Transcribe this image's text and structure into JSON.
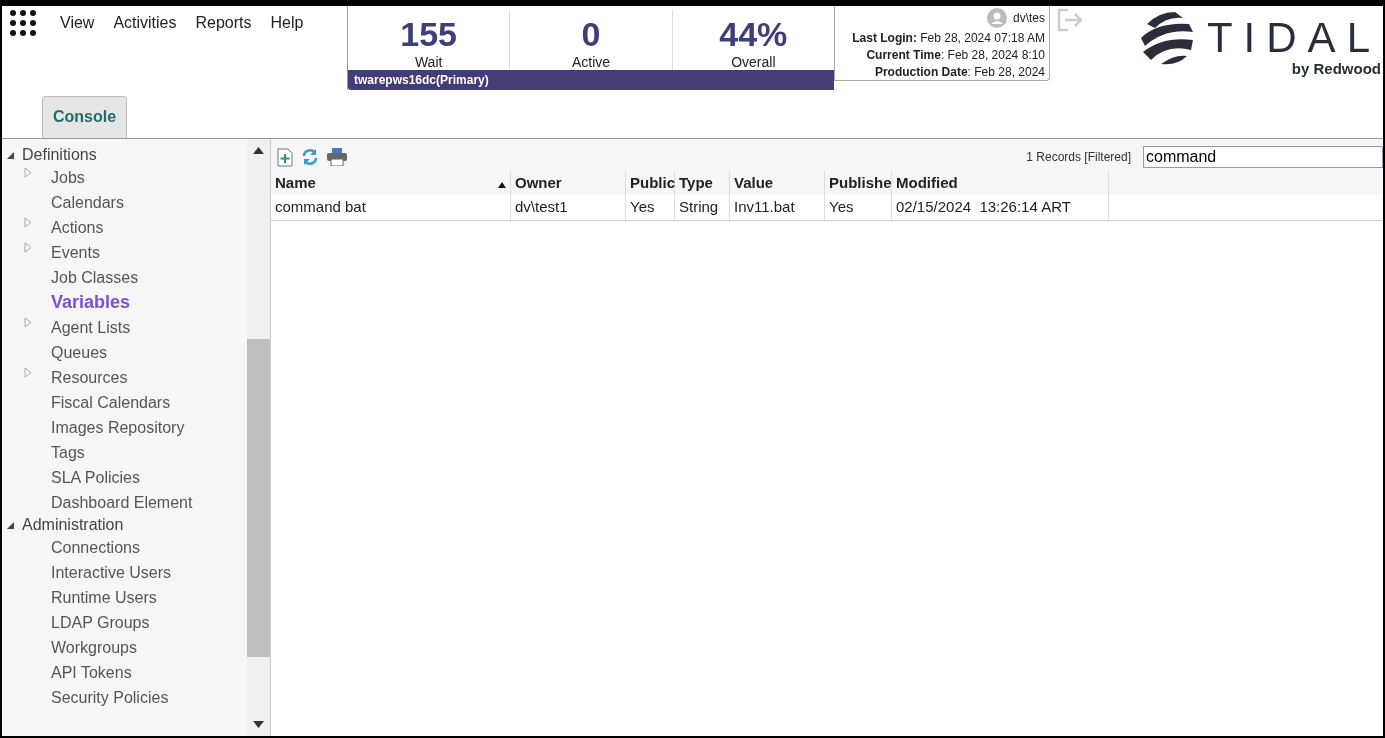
{
  "menu": [
    "View",
    "Activities",
    "Reports",
    "Help"
  ],
  "stats": [
    {
      "value": "155",
      "label": "Wait"
    },
    {
      "value": "0",
      "label": "Active"
    },
    {
      "value": "44%",
      "label": "Overall"
    }
  ],
  "server": "twarepws16dc(Primary)",
  "user": {
    "name": "dv\\tes",
    "info": [
      {
        "label": "Last Login:",
        "value": " Feb 28, 2024 07:18 AM"
      },
      {
        "label": "Current Time",
        "value": ": Feb 28, 2024 8:10"
      },
      {
        "label": "Production Date",
        "value": ": Feb 28, 2024"
      }
    ]
  },
  "logo": {
    "name": "TIDAL",
    "sub": "by Redwood"
  },
  "tabs": [
    {
      "label": "Console",
      "selected": true
    }
  ],
  "sidebar": {
    "items": [
      {
        "label": "Definitions",
        "expanded": true,
        "children": [
          {
            "label": "Jobs",
            "expandable": true,
            "selected": false
          },
          {
            "label": "Calendars",
            "expandable": false,
            "selected": false
          },
          {
            "label": "Actions",
            "expandable": true,
            "selected": false
          },
          {
            "label": "Events",
            "expandable": true,
            "selected": false
          },
          {
            "label": "Job Classes",
            "expandable": false,
            "selected": false
          },
          {
            "label": "Variables",
            "expandable": false,
            "selected": true
          },
          {
            "label": "Agent Lists",
            "expandable": true,
            "selected": false
          },
          {
            "label": "Queues",
            "expandable": false,
            "selected": false
          },
          {
            "label": "Resources",
            "expandable": true,
            "selected": false
          },
          {
            "label": "Fiscal Calendars",
            "expandable": false,
            "selected": false
          },
          {
            "label": "Images Repository",
            "expandable": false,
            "selected": false
          },
          {
            "label": "Tags",
            "expandable": false,
            "selected": false
          },
          {
            "label": "SLA Policies",
            "expandable": false,
            "selected": false
          },
          {
            "label": "Dashboard Element",
            "expandable": false,
            "selected": false
          }
        ]
      },
      {
        "label": "Administration",
        "expanded": true,
        "children": [
          {
            "label": "Connections",
            "expandable": false,
            "selected": false
          },
          {
            "label": "Interactive Users",
            "expandable": false,
            "selected": false
          },
          {
            "label": "Runtime Users",
            "expandable": false,
            "selected": false
          },
          {
            "label": "LDAP Groups",
            "expandable": false,
            "selected": false
          },
          {
            "label": "Workgroups",
            "expandable": false,
            "selected": false
          },
          {
            "label": "API Tokens",
            "expandable": false,
            "selected": false
          },
          {
            "label": "Security Policies",
            "expandable": false,
            "selected": false
          }
        ]
      }
    ]
  },
  "records": "1 Records [Filtered]",
  "search": {
    "value": "command"
  },
  "table": {
    "columns": [
      {
        "label": "Name",
        "sorted": true
      },
      {
        "label": "Owner"
      },
      {
        "label": "Public"
      },
      {
        "label": "Type"
      },
      {
        "label": "Value"
      },
      {
        "label": "Publishe"
      },
      {
        "label": "Modified"
      }
    ],
    "rows": [
      [
        "command bat",
        "dv\\test1",
        "Yes",
        "String",
        "Inv11.bat",
        "Yes",
        "02/15/2024  13:26:14 ART"
      ]
    ]
  }
}
